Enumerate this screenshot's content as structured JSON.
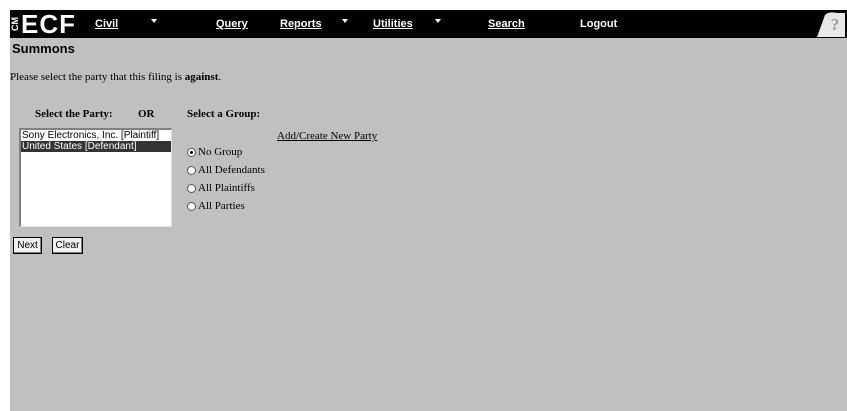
{
  "app": {
    "logo_cm": "CM",
    "logo_ecf": "ECF"
  },
  "menu": {
    "items": [
      {
        "label": "Civil",
        "has_dropdown": true
      },
      {
        "label": "Query",
        "has_dropdown": false
      },
      {
        "label": "Reports",
        "has_dropdown": true
      },
      {
        "label": "Utilities",
        "has_dropdown": true
      },
      {
        "label": "Search",
        "has_dropdown": false
      },
      {
        "label": "Logout",
        "has_dropdown": false
      }
    ],
    "help_icon": "help-question-icon"
  },
  "page": {
    "title": "Summons",
    "instruction_prefix": "Please select the party that this filing is ",
    "instruction_bold": "against",
    "instruction_suffix": "."
  },
  "party": {
    "label": "Select the Party:",
    "or_label": "OR",
    "options": [
      {
        "text": "Sony Electronics, Inc. [Plaintiff]",
        "selected": false
      },
      {
        "text": "United States [Defendant]",
        "selected": true
      }
    ]
  },
  "group": {
    "label": "Select a Group:",
    "add_link": "Add/Create New Party",
    "options": [
      {
        "text": "No Group",
        "checked": true
      },
      {
        "text": "All Defendants",
        "checked": false
      },
      {
        "text": "All Plaintiffs",
        "checked": false
      },
      {
        "text": "All Parties",
        "checked": false
      }
    ]
  },
  "buttons": {
    "next": "Next",
    "clear": "Clear"
  }
}
